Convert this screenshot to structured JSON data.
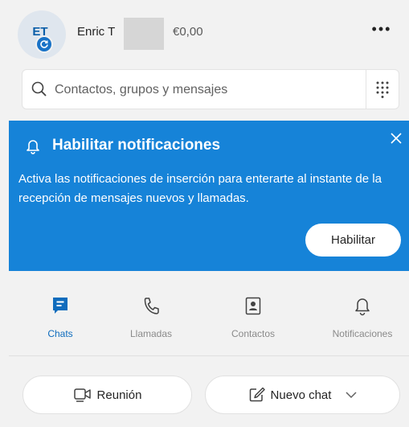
{
  "profile": {
    "initials": "ET",
    "name": "Enric T",
    "credit": "€0,00",
    "more_label": "•••",
    "presence_icon": "refresh-icon"
  },
  "search": {
    "placeholder": "Contactos, grupos y mensajes",
    "icon": "search-icon",
    "dialpad_icon": "dialpad-icon"
  },
  "banner": {
    "title": "Habilitar notificaciones",
    "text": "Activa las notificaciones de inserción para enterarte al instante de la recepción de mensajes nuevos y llamadas.",
    "button_label": "Habilitar",
    "background": "#1683d8",
    "icon": "bell-icon",
    "close_icon": "close-icon"
  },
  "tabs": [
    {
      "label": "Chats",
      "icon": "chat-icon",
      "active": true
    },
    {
      "label": "Llamadas",
      "icon": "phone-icon",
      "active": false
    },
    {
      "label": "Contactos",
      "icon": "contacts-icon",
      "active": false
    },
    {
      "label": "Notificaciones",
      "icon": "bell-icon",
      "active": false
    }
  ],
  "actions": {
    "meeting_label": "Reunión",
    "newchat_label": "Nuevo chat"
  },
  "colors": {
    "accent": "#0f6cbd",
    "inactive": "#8a8a8a"
  }
}
